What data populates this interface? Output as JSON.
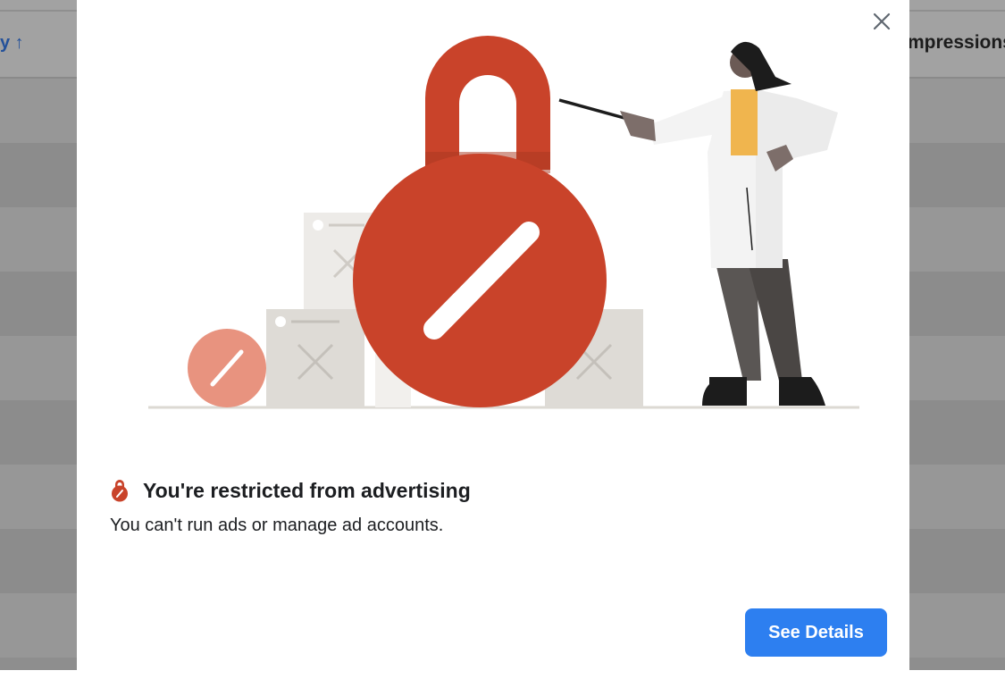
{
  "background": {
    "sort_indicator": "y ↑",
    "column_header": "mpressions"
  },
  "modal": {
    "title": "You're restricted from advertising",
    "message": "You can't run ads or manage ad accounts.",
    "primary_button": "See Details",
    "close_icon": "close-icon",
    "title_icon": "restricted-lock-icon"
  },
  "colors": {
    "accent": "#2d7ff0",
    "lock": "#c9432a",
    "lock_light": "#e8937f",
    "backdrop": "#8e8e8e"
  }
}
